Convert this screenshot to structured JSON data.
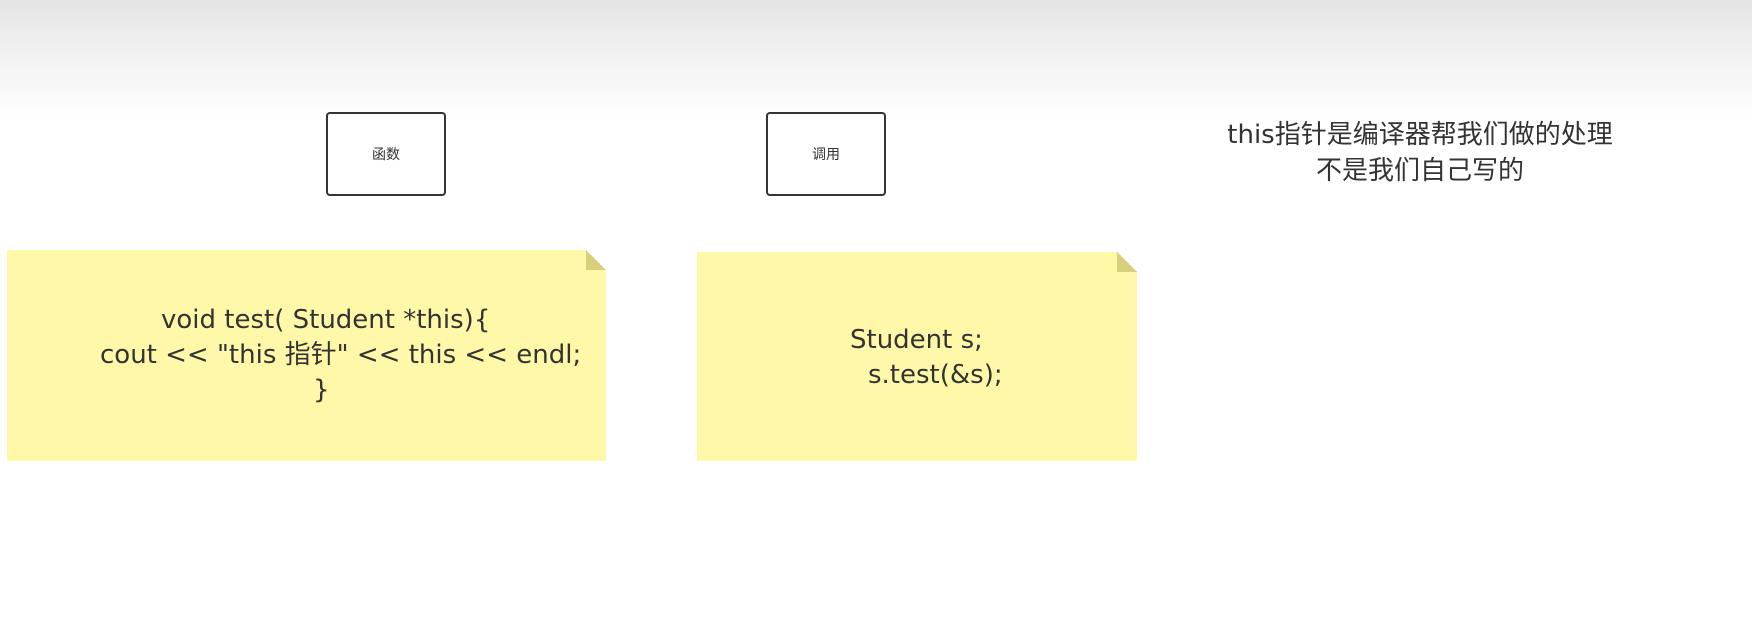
{
  "boxes": {
    "function_label": "函数",
    "call_label": "调用"
  },
  "notes": {
    "function_code": [
      "void test( Student *this){",
      "cout << \"this 指针\" << this << endl;",
      "}"
    ],
    "call_code": [
      "Student s;",
      "s.test(&s);"
    ]
  },
  "remark": {
    "line1": "this指针是编译器帮我们做的处理",
    "line2": "不是我们自己写的"
  },
  "colors": {
    "note_fill": "#fff8a8",
    "note_fold": "#d8cf7c",
    "border": "#333333",
    "text": "#333333"
  }
}
